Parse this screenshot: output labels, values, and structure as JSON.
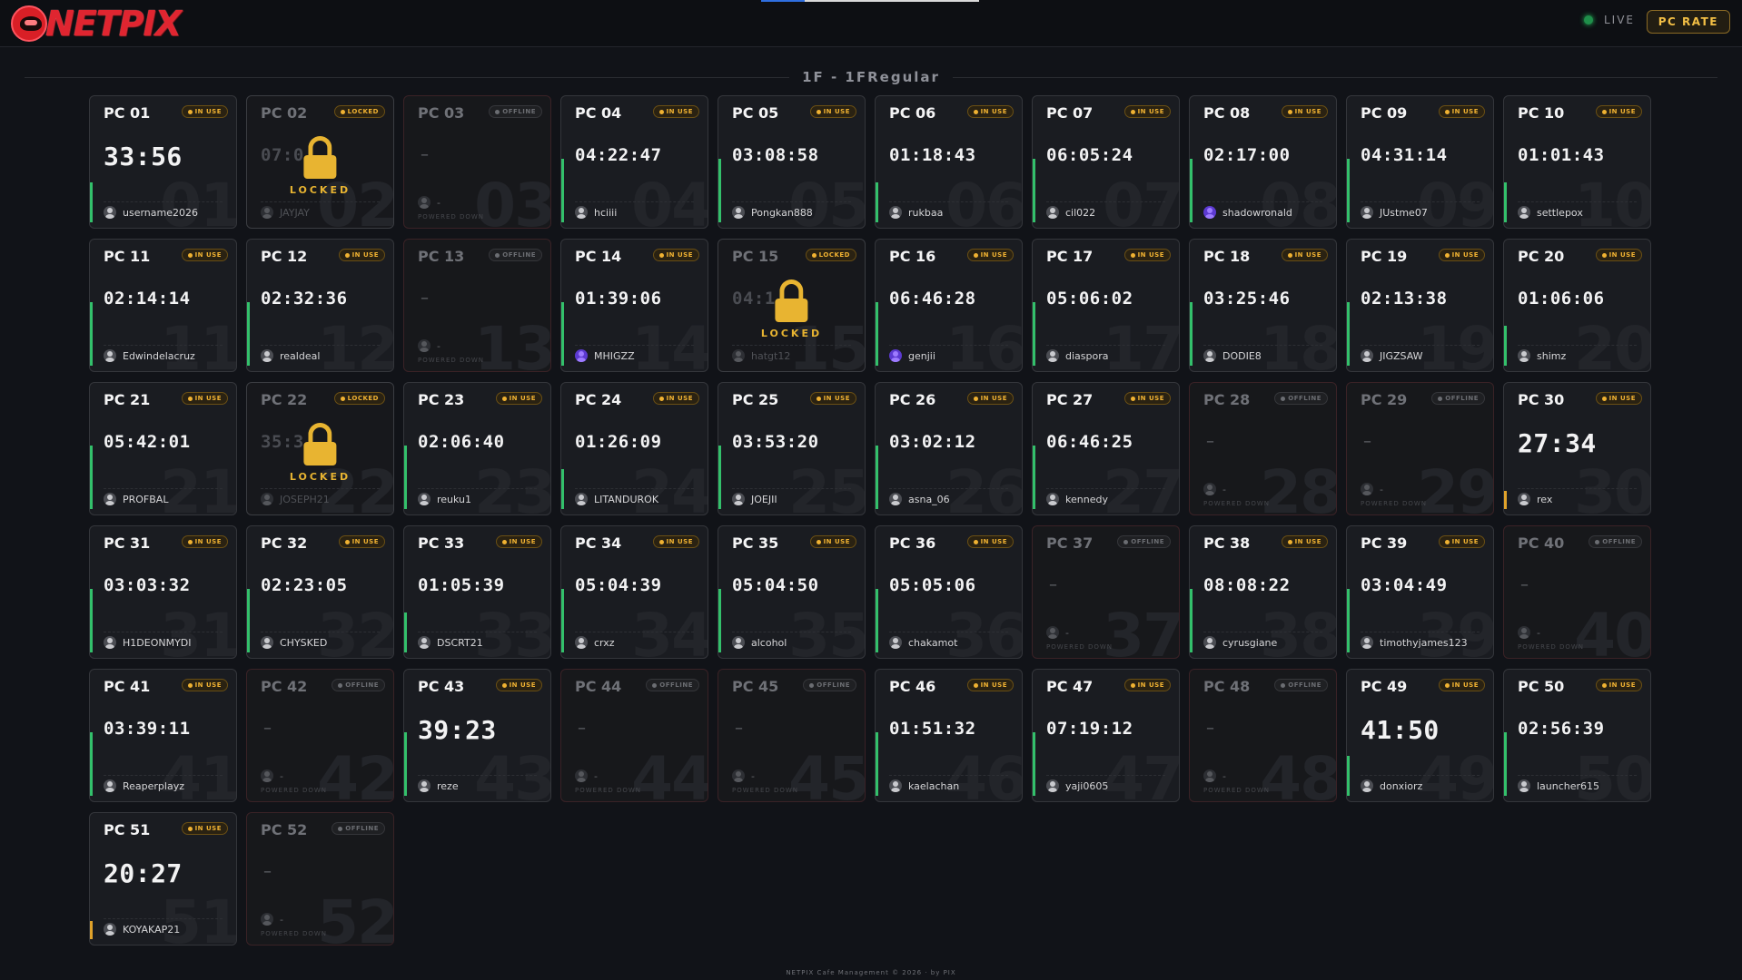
{
  "header": {
    "logo_text": "NETPIX",
    "live_label": "LIVE",
    "pc_rate_label": "PC RATE"
  },
  "section_title": "1F - 1FRegular",
  "colors": {
    "accent": "#f0b232",
    "in_use_stripe": "#33c06b",
    "brand": "#e02530"
  },
  "status_labels": {
    "in_use": "IN USE",
    "locked": "LOCKED",
    "offline": "OFFLINE"
  },
  "locked_overlay_label": "LOCKED",
  "powered_down_label": "POWERED DOWN",
  "pcs": [
    {
      "name": "PC 01",
      "status": "in_use",
      "time": "33:56",
      "big": true,
      "user": "username2026",
      "num": "01",
      "stripe": "short"
    },
    {
      "name": "PC 02",
      "status": "locked",
      "time": "07:0",
      "user": "JAYJAY",
      "num": "02"
    },
    {
      "name": "PC 03",
      "status": "offline",
      "time": "–",
      "user": "-",
      "num": "03"
    },
    {
      "name": "PC 04",
      "status": "in_use",
      "time": "04:22:47",
      "user": "hciiii",
      "num": "04",
      "stripe": "full"
    },
    {
      "name": "PC 05",
      "status": "in_use",
      "time": "03:08:58",
      "user": "Pongkan888",
      "num": "05",
      "stripe": "full"
    },
    {
      "name": "PC 06",
      "status": "in_use",
      "time": "01:18:43",
      "user": "rukbaa",
      "num": "06",
      "stripe": "short"
    },
    {
      "name": "PC 07",
      "status": "in_use",
      "time": "06:05:24",
      "user": "cil022",
      "num": "07",
      "stripe": "full"
    },
    {
      "name": "PC 08",
      "status": "in_use",
      "time": "02:17:00",
      "user": "shadowronald",
      "num": "08",
      "stripe": "full",
      "avatar": "purple"
    },
    {
      "name": "PC 09",
      "status": "in_use",
      "time": "04:31:14",
      "user": "JUstme07",
      "num": "09",
      "stripe": "full"
    },
    {
      "name": "PC 10",
      "status": "in_use",
      "time": "01:01:43",
      "user": "settlepox",
      "num": "10",
      "stripe": "short"
    },
    {
      "name": "PC 11",
      "status": "in_use",
      "time": "02:14:14",
      "user": "Edwindelacruz",
      "num": "11",
      "stripe": "full"
    },
    {
      "name": "PC 12",
      "status": "in_use",
      "time": "02:32:36",
      "user": "realdeal",
      "num": "12",
      "stripe": "full"
    },
    {
      "name": "PC 13",
      "status": "offline",
      "time": "–",
      "user": "-",
      "num": "13"
    },
    {
      "name": "PC 14",
      "status": "in_use",
      "time": "01:39:06",
      "user": "MHIGZZ",
      "num": "14",
      "stripe": "full",
      "avatar": "purple"
    },
    {
      "name": "PC 15",
      "status": "locked",
      "time": "04:1",
      "user": "hatgt12",
      "num": "15"
    },
    {
      "name": "PC 16",
      "status": "in_use",
      "time": "06:46:28",
      "user": "genjii",
      "num": "16",
      "stripe": "full",
      "avatar": "purple"
    },
    {
      "name": "PC 17",
      "status": "in_use",
      "time": "05:06:02",
      "user": "diaspora",
      "num": "17",
      "stripe": "full"
    },
    {
      "name": "PC 18",
      "status": "in_use",
      "time": "03:25:46",
      "user": "DODIE8",
      "num": "18",
      "stripe": "full"
    },
    {
      "name": "PC 19",
      "status": "in_use",
      "time": "02:13:38",
      "user": "JIGZSAW",
      "num": "19",
      "stripe": "full"
    },
    {
      "name": "PC 20",
      "status": "in_use",
      "time": "01:06:06",
      "user": "shimz",
      "num": "20",
      "stripe": "short"
    },
    {
      "name": "PC 21",
      "status": "in_use",
      "time": "05:42:01",
      "user": "PROFBAL",
      "num": "21",
      "stripe": "full"
    },
    {
      "name": "PC 22",
      "status": "locked",
      "time": "35:3",
      "user": "JOSEPH21",
      "num": "22"
    },
    {
      "name": "PC 23",
      "status": "in_use",
      "time": "02:06:40",
      "user": "reuku1",
      "num": "23",
      "stripe": "full"
    },
    {
      "name": "PC 24",
      "status": "in_use",
      "time": "01:26:09",
      "user": "LITANDUROK",
      "num": "24",
      "stripe": "short"
    },
    {
      "name": "PC 25",
      "status": "in_use",
      "time": "03:53:20",
      "user": "JOEJII",
      "num": "25",
      "stripe": "full"
    },
    {
      "name": "PC 26",
      "status": "in_use",
      "time": "03:02:12",
      "user": "asna_06",
      "num": "26",
      "stripe": "full"
    },
    {
      "name": "PC 27",
      "status": "in_use",
      "time": "06:46:25",
      "user": "kennedy",
      "num": "27",
      "stripe": "full"
    },
    {
      "name": "PC 28",
      "status": "offline",
      "time": "–",
      "user": "-",
      "num": "28"
    },
    {
      "name": "PC 29",
      "status": "offline",
      "time": "–",
      "user": "-",
      "num": "29"
    },
    {
      "name": "PC 30",
      "status": "in_use",
      "time": "27:34",
      "big": true,
      "user": "rex",
      "num": "30",
      "stripe": "amber"
    },
    {
      "name": "PC 31",
      "status": "in_use",
      "time": "03:03:32",
      "user": "H1DEONMYDI",
      "num": "31",
      "stripe": "full"
    },
    {
      "name": "PC 32",
      "status": "in_use",
      "time": "02:23:05",
      "user": "CHYSKED",
      "num": "32",
      "stripe": "full"
    },
    {
      "name": "PC 33",
      "status": "in_use",
      "time": "01:05:39",
      "user": "DSCRT21",
      "num": "33",
      "stripe": "short"
    },
    {
      "name": "PC 34",
      "status": "in_use",
      "time": "05:04:39",
      "user": "crxz",
      "num": "34",
      "stripe": "full"
    },
    {
      "name": "PC 35",
      "status": "in_use",
      "time": "05:04:50",
      "user": "alcohol",
      "num": "35",
      "stripe": "full"
    },
    {
      "name": "PC 36",
      "status": "in_use",
      "time": "05:05:06",
      "user": "chakamot",
      "num": "36",
      "stripe": "full"
    },
    {
      "name": "PC 37",
      "status": "offline",
      "time": "–",
      "user": "-",
      "num": "37"
    },
    {
      "name": "PC 38",
      "status": "in_use",
      "time": "08:08:22",
      "user": "cyrusgiane",
      "num": "38",
      "stripe": "full"
    },
    {
      "name": "PC 39",
      "status": "in_use",
      "time": "03:04:49",
      "user": "timothyjames123",
      "num": "39",
      "stripe": "full"
    },
    {
      "name": "PC 40",
      "status": "offline",
      "time": "–",
      "user": "-",
      "num": "40"
    },
    {
      "name": "PC 41",
      "status": "in_use",
      "time": "03:39:11",
      "user": "Reaperplayz",
      "num": "41",
      "stripe": "full"
    },
    {
      "name": "PC 42",
      "status": "offline",
      "time": "–",
      "user": "-",
      "num": "42"
    },
    {
      "name": "PC 43",
      "status": "in_use",
      "time": "39:23",
      "big": true,
      "user": "reze",
      "num": "43",
      "stripe": "full"
    },
    {
      "name": "PC 44",
      "status": "offline",
      "time": "–",
      "user": "-",
      "num": "44"
    },
    {
      "name": "PC 45",
      "status": "offline",
      "time": "–",
      "user": "-",
      "num": "45"
    },
    {
      "name": "PC 46",
      "status": "in_use",
      "time": "01:51:32",
      "user": "kaelachan",
      "num": "46",
      "stripe": "full"
    },
    {
      "name": "PC 47",
      "status": "in_use",
      "time": "07:19:12",
      "user": "yaji0605",
      "num": "47",
      "stripe": "full"
    },
    {
      "name": "PC 48",
      "status": "offline",
      "time": "–",
      "user": "-",
      "num": "48"
    },
    {
      "name": "PC 49",
      "status": "in_use",
      "time": "41:50",
      "big": true,
      "user": "donxiorz",
      "num": "49",
      "stripe": "short"
    },
    {
      "name": "PC 50",
      "status": "in_use",
      "time": "02:56:39",
      "user": "launcher615",
      "num": "50",
      "stripe": "full"
    },
    {
      "name": "PC 51",
      "status": "in_use",
      "time": "20:27",
      "big": true,
      "user": "KOYAKAP21",
      "num": "51",
      "stripe": "amber"
    },
    {
      "name": "PC 52",
      "status": "offline",
      "time": "–",
      "user": "-",
      "num": "52"
    }
  ],
  "footer": "NETPIX Cafe Management © 2026 · by PIX"
}
